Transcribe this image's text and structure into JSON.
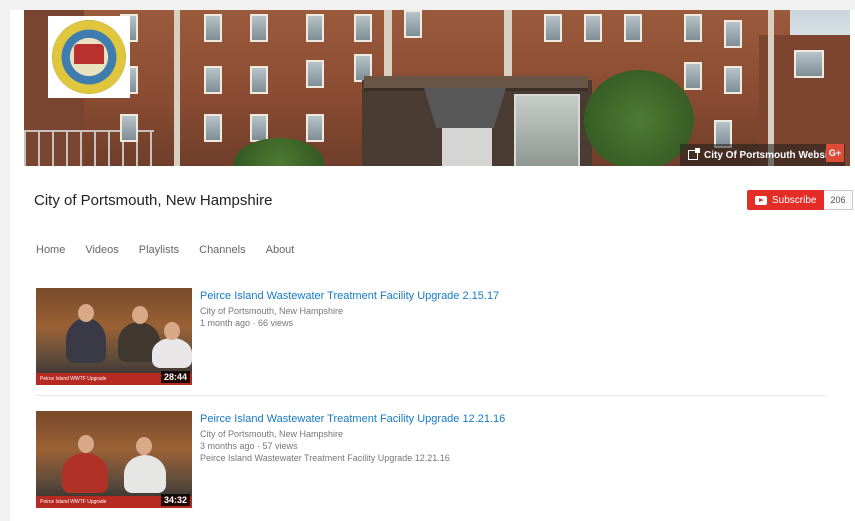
{
  "banner": {
    "website_link": "City Of Portsmouth Website",
    "gplus_label": "G+"
  },
  "channel": {
    "title": "City of Portsmouth, New Hampshire",
    "subscribe_label": "Subscribe",
    "subscriber_count": "206"
  },
  "tabs": [
    "Home",
    "Videos",
    "Playlists",
    "Channels",
    "About"
  ],
  "videos": [
    {
      "title": "Peirce Island Wastewater Treatment Facility Upgrade 2.15.17",
      "channel": "City of Portsmouth, New Hampshire",
      "meta": "1 month ago · 66 views",
      "description": "",
      "thumb_caption": "Peirce Island WWTF Upgrade",
      "duration": "28:44"
    },
    {
      "title": "Peirce Island Wastewater Treatment Facility Upgrade 12.21.16",
      "channel": "City of Portsmouth, New Hampshire",
      "meta": "3 months ago · 57 views",
      "description": "Peirce Island Wastewater Treatment Facility Upgrade 12.21.16",
      "thumb_caption": "Peirce Island WWTF Upgrade",
      "duration": "34:32"
    }
  ],
  "colors": {
    "subscribe": "#e52d27",
    "link": "#167ac6",
    "gplus": "#dd4b39"
  }
}
